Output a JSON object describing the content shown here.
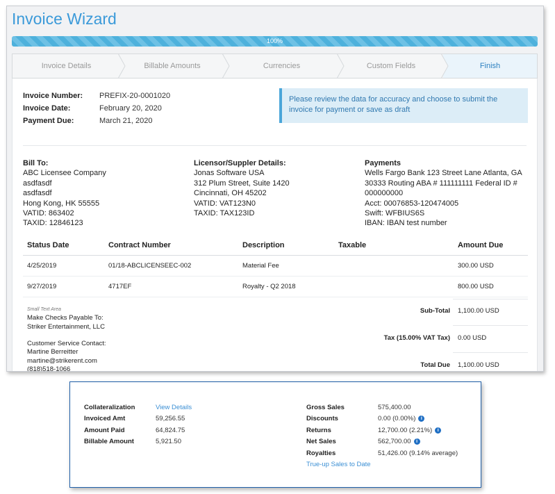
{
  "wizard": {
    "title": "Invoice Wizard",
    "progress_label": "100%",
    "progress_fraction": 1.0,
    "steps": [
      {
        "label": "Invoice Details",
        "active": false
      },
      {
        "label": "Billable Amounts",
        "active": false
      },
      {
        "label": "Currencies",
        "active": false
      },
      {
        "label": "Custom Fields",
        "active": false
      },
      {
        "label": "Finish",
        "active": true
      }
    ]
  },
  "invoice": {
    "number_label": "Invoice Number:",
    "number": "PREFIX-20-0001020",
    "date_label": "Invoice Date:",
    "date": "February 20, 2020",
    "due_label": "Payment Due:",
    "due": "March 21, 2020",
    "notice": "Please review the data for accuracy and choose to submit the invoice for payment or save as draft"
  },
  "bill_to": {
    "heading": "Bill To:",
    "lines": [
      "ABC Licensee Company",
      "asdfasdf",
      "asdfasdf",
      "Hong Kong, HK 55555",
      "VATID: 863402",
      "TAXID: 12846123"
    ]
  },
  "licensor": {
    "heading": "Licensor/Suppler Details:",
    "lines": [
      "Jonas Software USA",
      "312 Plum Street, Suite 1420",
      "Cincinnati, OH 45202",
      "VATID: VAT123N0",
      "TAXID: TAX123ID"
    ]
  },
  "payments": {
    "heading": "Payments",
    "lines": [
      "Wells Fargo Bank 123 Street Lane Atlanta, GA",
      "30333 Routing ABA # 111111111 Federal ID #",
      "000000000",
      "Acct: 00076853-120474005",
      "Swift: WFBIUS6S",
      "IBAN: IBAN test number"
    ]
  },
  "table": {
    "headers": [
      "Status Date",
      "Contract Number",
      "Description",
      "Taxable",
      "Amount Due"
    ],
    "rows": [
      [
        "4/25/2019",
        "01/18-ABCLICENSEEC-002",
        "Material Fee",
        "",
        "300.00 USD"
      ],
      [
        "9/27/2019",
        "4717EF",
        "Royalty - Q2 2018",
        "",
        "800.00 USD"
      ]
    ]
  },
  "footer": {
    "small_text": "Small Text Area",
    "lines": [
      "Make Checks Payable To:",
      "Striker Entertainment, LLC",
      "",
      "Customer Service Contact:",
      "Martine Berreitter",
      "martine@strikerent.com",
      "(818)518-1066"
    ],
    "subtotal_label": "Sub-Total",
    "subtotal": "1,100.00 USD",
    "tax_label": "Tax (15.00% VAT Tax)",
    "tax": "0.00 USD",
    "total_label": "Total Due",
    "total": "1,100.00 USD"
  },
  "summary": {
    "collateralization_label": "Collateralization",
    "view_details": "View Details",
    "invoiced_label": "Invoiced Amt",
    "invoiced": "59,256.55",
    "paid_label": "Amount Paid",
    "paid": "64,824.75",
    "billable_label": "Billable Amount",
    "billable": "5,921.50",
    "gross_label": "Gross Sales",
    "gross": "575,400.00",
    "discounts_label": "Discounts",
    "discounts": "0.00 (0.00%)",
    "returns_label": "Returns",
    "returns": "12,700.00 (2.21%)",
    "net_label": "Net Sales",
    "net": "562,700.00",
    "royalties_label": "Royalties",
    "royalties": "51,426.00 (9.14% average)",
    "trueup_link": "True-up Sales to Date",
    "info_glyph": "i"
  }
}
